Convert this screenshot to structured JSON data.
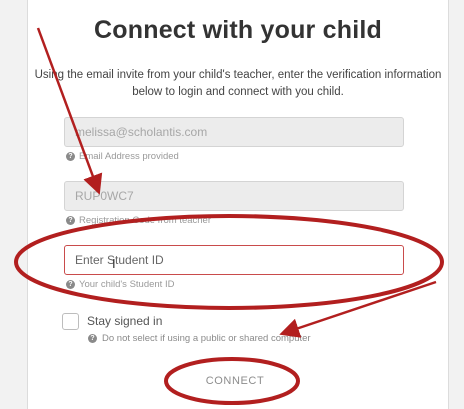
{
  "page": {
    "title": "Connect with your child",
    "intro": "Using the email invite from your child's teacher, enter the verification information below to login and connect with you child."
  },
  "email": {
    "value": "melissa@scholantis.com",
    "hint": "Email Address provided"
  },
  "registration": {
    "value": "RUP0WC7",
    "hint": "Registration Code from teacher"
  },
  "student_id": {
    "placeholder": "Enter Student ID",
    "hint": "Your child's Student ID"
  },
  "stay_signed_in": {
    "label": "Stay signed in",
    "hint": "Do not select if using a public or shared computer"
  },
  "connect_button": {
    "label": "CONNECT"
  },
  "icons": {
    "help": "?"
  },
  "colors": {
    "annotation": "#b21f1f",
    "active_border": "#c94b4b"
  }
}
